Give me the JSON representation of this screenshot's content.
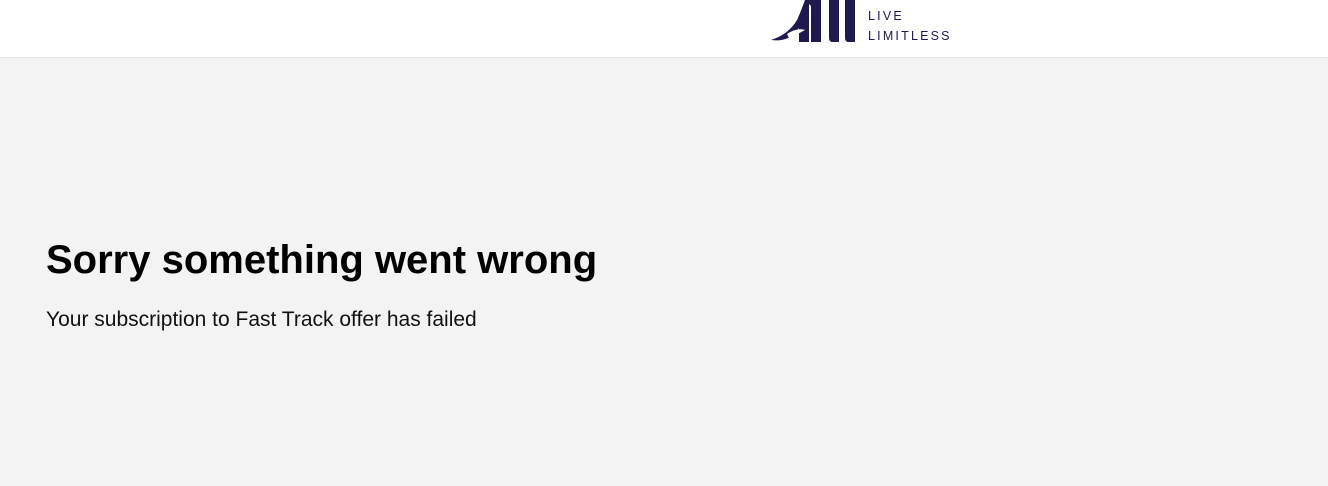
{
  "header": {
    "logo": {
      "icon": "all-accor-logo-icon",
      "tagline_line1": "LIVE",
      "tagline_line2": "LIMITLESS",
      "color": "#1e1a4e"
    }
  },
  "main": {
    "title": "Sorry something went wrong",
    "message": "Your subscription to Fast Track offer has failed"
  },
  "colors": {
    "page_background": "#f3f3f3",
    "header_background": "#ffffff",
    "brand_navy": "#1e1a4e"
  }
}
